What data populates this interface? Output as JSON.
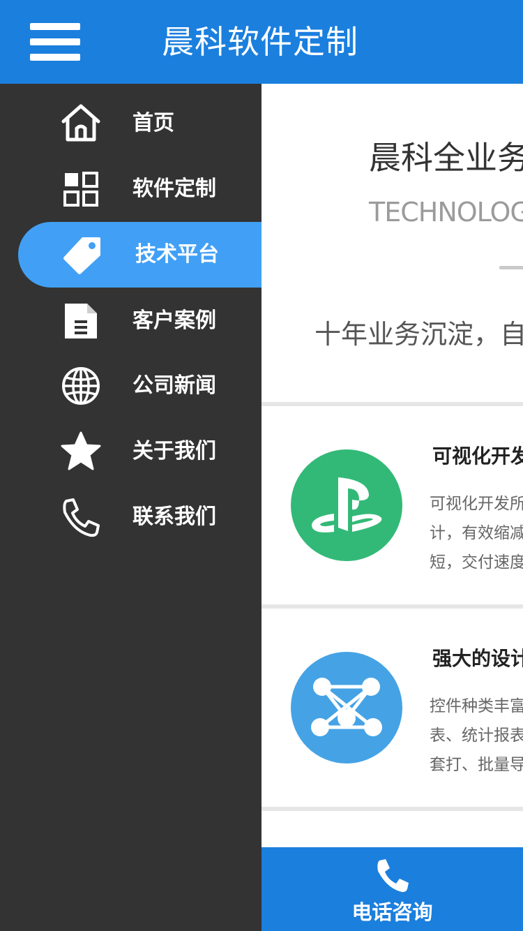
{
  "header": {
    "title": "晨科软件定制",
    "menu_icon": "hamburger-menu-icon",
    "background": "#1b7fde"
  },
  "sidebar": {
    "background": "#333333",
    "active_color": "#41a0f5",
    "items": [
      {
        "label": "首页",
        "icon": "home-icon",
        "active": false
      },
      {
        "label": "软件定制",
        "icon": "grid-icon",
        "active": false
      },
      {
        "label": "技术平台",
        "icon": "tag-icon",
        "active": true
      },
      {
        "label": "客户案例",
        "icon": "document-icon",
        "active": false
      },
      {
        "label": "公司新闻",
        "icon": "globe-icon",
        "active": false
      },
      {
        "label": "关于我们",
        "icon": "star-icon",
        "active": false
      },
      {
        "label": "联系我们",
        "icon": "phone-icon",
        "active": false
      }
    ]
  },
  "main": {
    "hero": {
      "title": "晨科全业务",
      "subtitle": "TECHNOLOGY",
      "description": "十年业务沉淀，自"
    },
    "features": [
      {
        "title": "可视化开发",
        "lines": [
          "可视化开发所",
          "计，有效缩减",
          "短，交付速度"
        ],
        "icon": "playstation-logo-icon",
        "color": "#33b977"
      },
      {
        "title": "强大的设计",
        "lines": [
          "控件种类丰富",
          "表、统计报表",
          "套打、批量导"
        ],
        "icon": "network-nodes-icon",
        "color": "#45a3e5"
      }
    ]
  },
  "callbar": {
    "label": "电话咨询",
    "icon": "phone-icon",
    "background": "#1b7fde"
  }
}
